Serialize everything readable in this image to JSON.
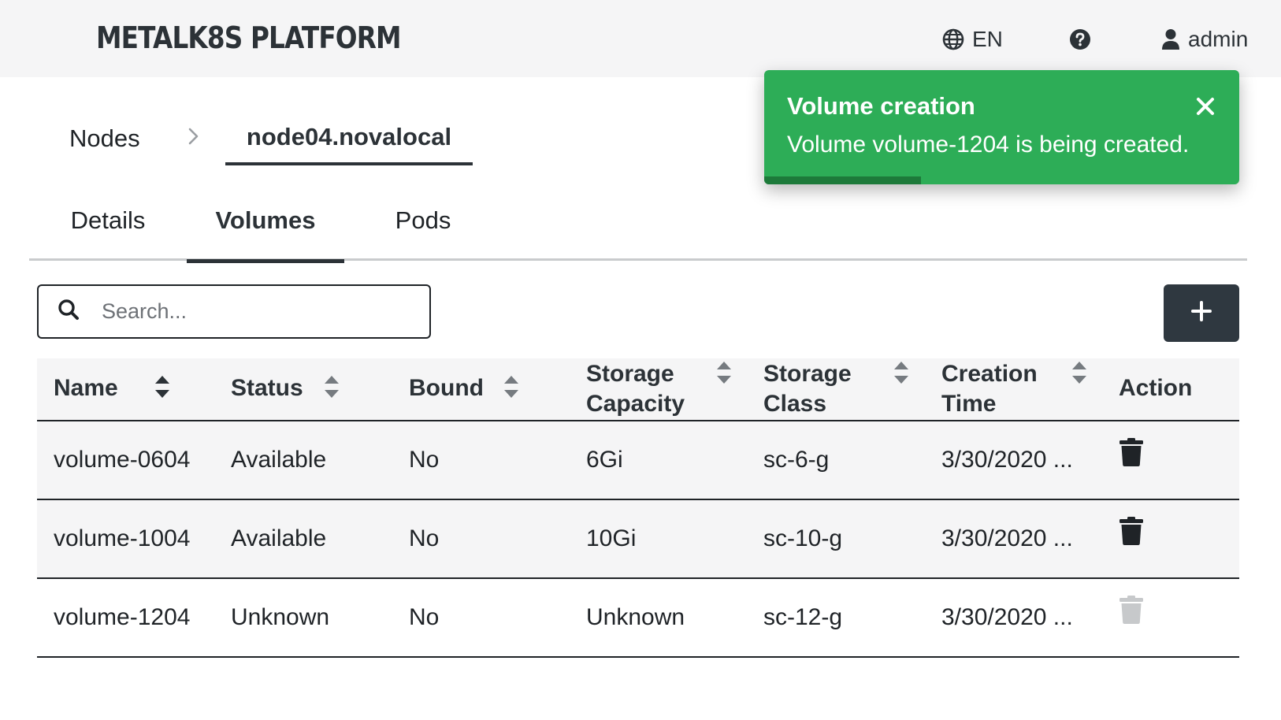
{
  "header": {
    "brand": "METALK8S PLATFORM",
    "language": "EN",
    "user": "admin"
  },
  "breadcrumb": {
    "parent": "Nodes",
    "current": "node04.novalocal"
  },
  "tabs": [
    {
      "label": "Details",
      "active": false
    },
    {
      "label": "Volumes",
      "active": true
    },
    {
      "label": "Pods",
      "active": false
    }
  ],
  "search": {
    "placeholder": "Search...",
    "value": ""
  },
  "table": {
    "columns": [
      {
        "label": "Name",
        "sortable": true
      },
      {
        "label": "Status",
        "sortable": true
      },
      {
        "label": "Bound",
        "sortable": true
      },
      {
        "label": "Storage Capacity",
        "sortable": true
      },
      {
        "label": "Storage Class",
        "sortable": true
      },
      {
        "label": "Creation Time",
        "sortable": true
      },
      {
        "label": "Action",
        "sortable": false
      }
    ],
    "rows": [
      {
        "name": "volume-0604",
        "status": "Available",
        "bound": "No",
        "capacity": "6Gi",
        "storage_class": "sc-6-g",
        "creation_time": "3/30/2020 ...",
        "delete_enabled": true
      },
      {
        "name": "volume-1004",
        "status": "Available",
        "bound": "No",
        "capacity": "10Gi",
        "storage_class": "sc-10-g",
        "creation_time": "3/30/2020 ...",
        "delete_enabled": true
      },
      {
        "name": "volume-1204",
        "status": "Unknown",
        "bound": "No",
        "capacity": "Unknown",
        "storage_class": "sc-12-g",
        "creation_time": "3/30/2020 ...",
        "delete_enabled": false
      }
    ]
  },
  "toast": {
    "title": "Volume creation",
    "message": "Volume volume-1204 is being created.",
    "progress": 0.33
  },
  "icons": {
    "language": "globe-icon",
    "help": "question-circle-icon",
    "user": "user-icon",
    "search": "search-icon",
    "add": "plus-icon",
    "sort": "sort-icon",
    "delete": "trash-icon",
    "close": "close-icon",
    "breadcrumb_separator": "chevron-right-icon"
  },
  "colors": {
    "header_bg": "#f5f5f6",
    "primary_dark": "#2f3840",
    "toast_success": "#2dad57",
    "toast_progress": "#1d7a3a",
    "disabled_icon": "#c7c9cb"
  }
}
